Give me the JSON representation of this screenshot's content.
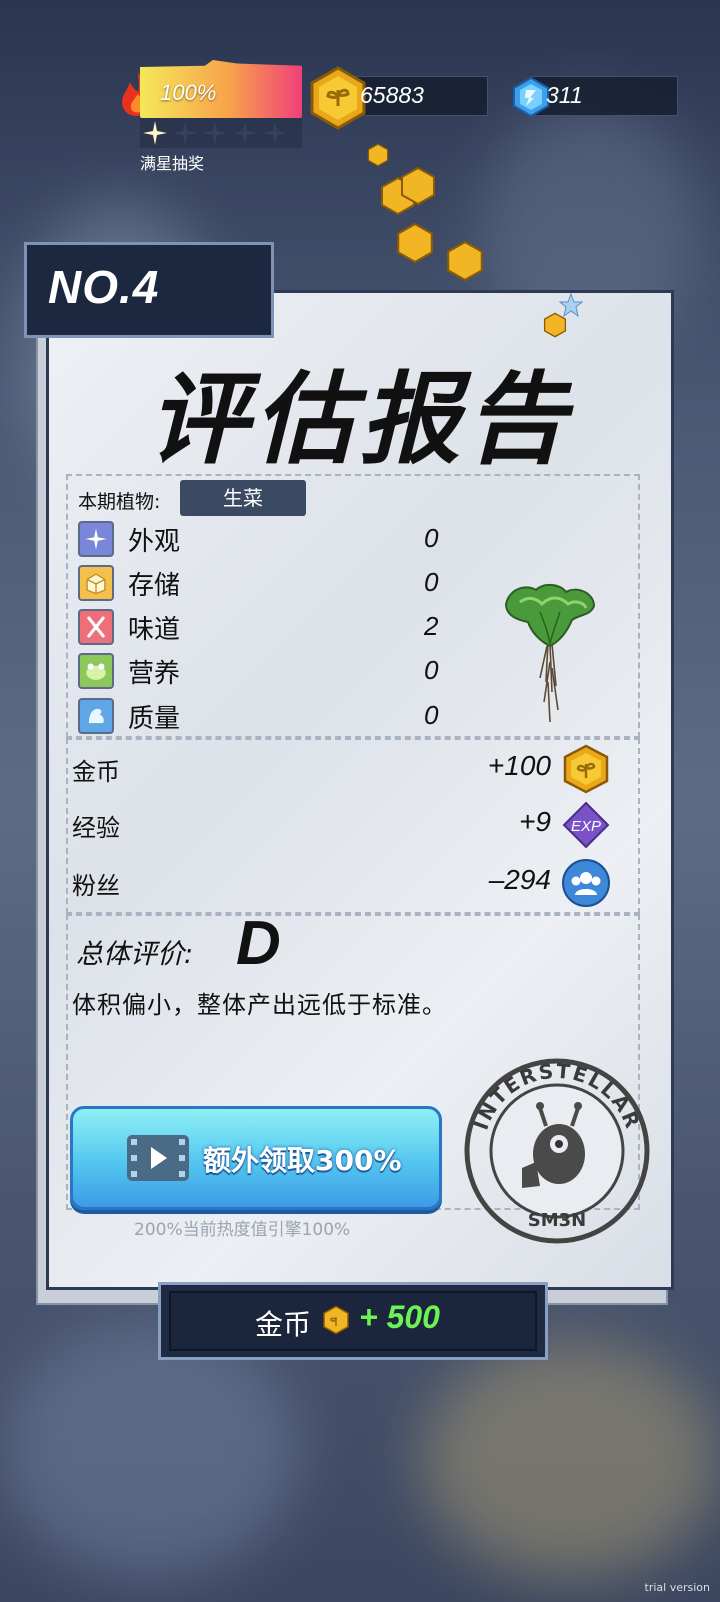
{
  "hud": {
    "heat_percent": "100%",
    "star_lottery_label": "满星抽奖",
    "stars_filled": 1,
    "stars_total": 5,
    "coins": "65883",
    "gems": "311"
  },
  "report": {
    "number": "NO.4",
    "title": "评估报告",
    "plant_label": "本期植物:",
    "plant_name": "生菜",
    "attributes": [
      {
        "label": "外观",
        "value": "0",
        "icon": "sparkle-icon",
        "color": "#7a86d9"
      },
      {
        "label": "存储",
        "value": "0",
        "icon": "storage-box-icon",
        "color": "#f3c04e"
      },
      {
        "label": "味道",
        "value": "2",
        "icon": "fork-knife-icon",
        "color": "#ee6f7a"
      },
      {
        "label": "营养",
        "value": "0",
        "icon": "nutrition-frog-icon",
        "color": "#8cc85c"
      },
      {
        "label": "质量",
        "value": "0",
        "icon": "muscle-arm-icon",
        "color": "#5fa6e6"
      }
    ],
    "rewards": [
      {
        "label": "金币",
        "value": "+100",
        "icon": "gold-coin-icon"
      },
      {
        "label": "经验",
        "value": "+9",
        "icon": "exp-badge-icon",
        "icon_text": "EXP"
      },
      {
        "label": "粉丝",
        "value": "–294",
        "icon": "fans-icon"
      }
    ],
    "overall_label": "总体评价:",
    "grade": "D",
    "comment": "体积偏小，整体产出远低于标准。",
    "extra_button": "额外领取300%",
    "hint": "200%当前热度值引擎100%",
    "stamp_top": "INTERSTELLAR",
    "stamp_bottom": "SM3N"
  },
  "claim": {
    "label": "金币",
    "amount": "+ 500"
  },
  "watermark": "trial version"
}
